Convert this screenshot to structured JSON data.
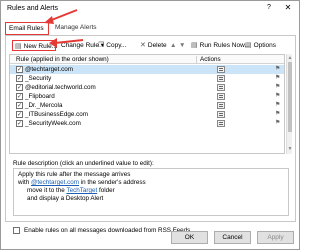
{
  "window": {
    "title": "Rules and Alerts",
    "help": "?",
    "close": "✕"
  },
  "tabs": [
    {
      "label": "Email Rules",
      "active": true
    },
    {
      "label": "Manage Alerts",
      "active": false
    }
  ],
  "toolbar": {
    "new_rule": "New Rule...",
    "change_rule": "Change Rule",
    "copy": "Copy...",
    "delete": "Delete",
    "move_up": "▲",
    "move_down": "▼",
    "run_rules": "Run Rules Now...",
    "options": "Options"
  },
  "grid": {
    "col_rule": "Rule (applied in the order shown)",
    "col_actions": "Actions",
    "rows": [
      {
        "name": "@techtarget.com",
        "selected": true
      },
      {
        "name": "_Security",
        "selected": false
      },
      {
        "name": "@editorial.techworld.com",
        "selected": false
      },
      {
        "name": "_Flipboard",
        "selected": false
      },
      {
        "name": "_Dr._Mercola",
        "selected": false
      },
      {
        "name": "_ITBusinessEdge.com",
        "selected": false
      },
      {
        "name": "_SecurityWeek.com",
        "selected": false
      }
    ]
  },
  "description": {
    "label": "Rule description (click an underlined value to edit):",
    "line1": "Apply this rule after the message arrives",
    "line2_prefix": "with ",
    "line2_link": "@techtarget.com",
    "line2_suffix": " in the sender's address",
    "line3_prefix": "move it to the ",
    "line3_link": "TechTarget",
    "line3_suffix": " folder",
    "line4": "and display a Desktop Alert"
  },
  "rss": {
    "label": "Enable rules on all messages downloaded from RSS Feeds"
  },
  "buttons": {
    "ok": "OK",
    "cancel": "Cancel",
    "apply": "Apply"
  },
  "colors": {
    "highlight": "#e53935",
    "selection": "#cce4f7",
    "link": "#1a5fb4"
  }
}
